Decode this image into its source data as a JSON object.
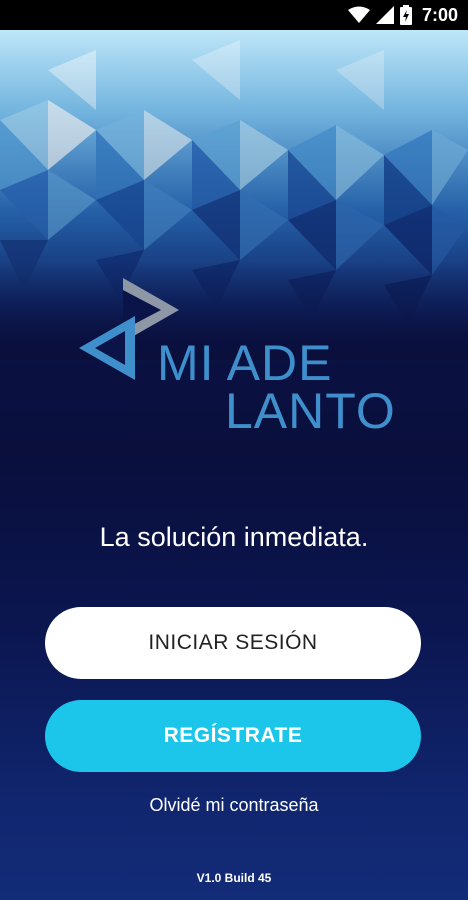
{
  "status_bar": {
    "time": "7:00",
    "icons": [
      "wifi-icon",
      "cell-signal-icon",
      "battery-icon"
    ]
  },
  "logo": {
    "line1": "MI ADE",
    "line2": "LANTO"
  },
  "tagline": "La solución inmediata.",
  "buttons": {
    "login_label": "INICIAR SESIÓN",
    "register_label": "REGÍSTRATE"
  },
  "forgot_password": "Olvidé mi contraseña",
  "version": "V1.0 Build 45",
  "colors": {
    "background_dark": "#0a0f3c",
    "logo_blue": "#3f8fcd",
    "register_button": "#1cc6ea",
    "login_button": "#ffffff"
  }
}
